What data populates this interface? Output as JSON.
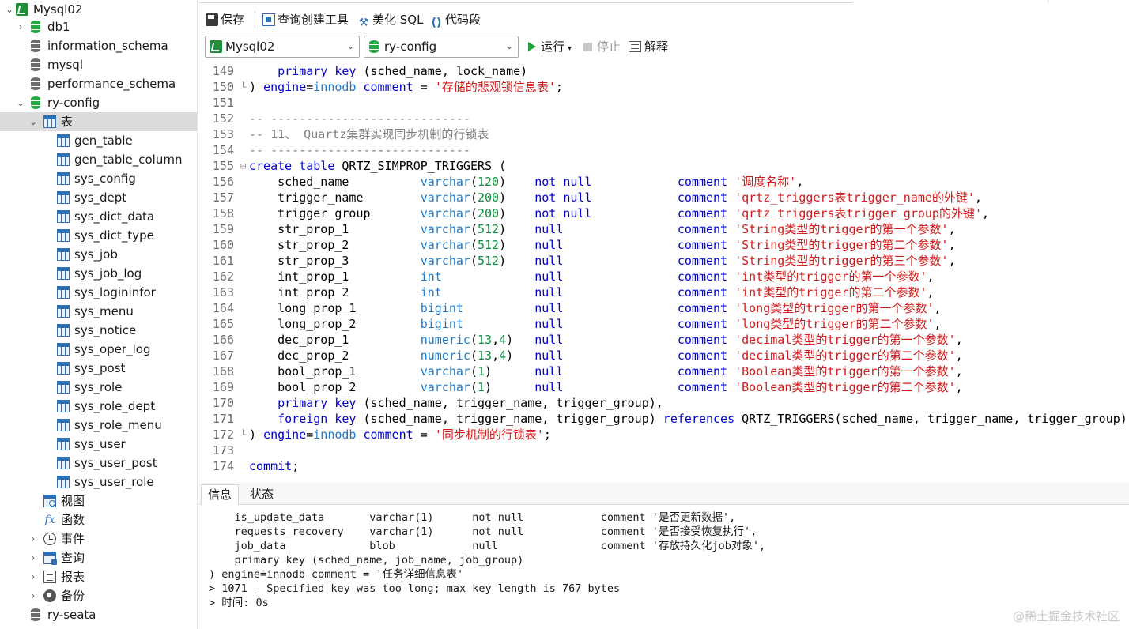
{
  "sidebar": {
    "connection": "Mysql02",
    "databases": {
      "db1": "db1",
      "information_schema": "information_schema",
      "mysql": "mysql",
      "performance_schema": "performance_schema",
      "ry_config": "ry-config",
      "ry_seata": "ry-seata"
    },
    "tables_folder": "表",
    "tables": [
      "gen_table",
      "gen_table_column",
      "sys_config",
      "sys_dept",
      "sys_dict_data",
      "sys_dict_type",
      "sys_job",
      "sys_job_log",
      "sys_logininfor",
      "sys_menu",
      "sys_notice",
      "sys_oper_log",
      "sys_post",
      "sys_role",
      "sys_role_dept",
      "sys_role_menu",
      "sys_user",
      "sys_user_post",
      "sys_user_role"
    ],
    "views": "视图",
    "functions": "函数",
    "events": "事件",
    "queries": "查询",
    "reports": "报表",
    "backups": "备份"
  },
  "toolbar": {
    "save": "保存",
    "query_builder": "查询创建工具",
    "beautify": "美化 SQL",
    "snippet": "代码段"
  },
  "selectors": {
    "connection": "Mysql02",
    "database": "ry-config",
    "run": "运行",
    "stop": "停止",
    "explain": "解释"
  },
  "editor": {
    "lines": [
      {
        "n": "149",
        "fold": "",
        "segs": [
          [
            "pl",
            "    "
          ],
          [
            "kw",
            "primary key"
          ],
          [
            "pl",
            " (sched_name, lock_name)"
          ]
        ]
      },
      {
        "n": "150",
        "fold": "└",
        "segs": [
          [
            "pl",
            ") "
          ],
          [
            "kw",
            "engine"
          ],
          [
            "pl",
            "="
          ],
          [
            "ty",
            "innodb"
          ],
          [
            "pl",
            " "
          ],
          [
            "kw",
            "comment"
          ],
          [
            "pl",
            " = "
          ],
          [
            "str",
            "'存储的悲观锁信息表'"
          ],
          [
            "pl",
            ";"
          ]
        ]
      },
      {
        "n": "151",
        "fold": "",
        "segs": []
      },
      {
        "n": "152",
        "fold": "",
        "segs": [
          [
            "cm",
            "-- ----------------------------"
          ]
        ]
      },
      {
        "n": "153",
        "fold": "",
        "segs": [
          [
            "cm",
            "-- 11、 Quartz集群实现同步机制的行锁表"
          ]
        ]
      },
      {
        "n": "154",
        "fold": "",
        "segs": [
          [
            "cm",
            "-- ----------------------------"
          ]
        ]
      },
      {
        "n": "155",
        "fold": "⊟",
        "segs": [
          [
            "kw",
            "create table"
          ],
          [
            "pl",
            " QRTZ_SIMPROP_TRIGGERS ("
          ]
        ]
      },
      {
        "n": "156",
        "fold": "",
        "segs": [
          [
            "pl",
            "    sched_name          "
          ],
          [
            "ty",
            "varchar"
          ],
          [
            "pl",
            "("
          ],
          [
            "num",
            "120"
          ],
          [
            "pl",
            ")    "
          ],
          [
            "kw",
            "not null"
          ],
          [
            "pl",
            "            "
          ],
          [
            "kw",
            "comment"
          ],
          [
            "pl",
            " "
          ],
          [
            "str",
            "'调度名称'"
          ],
          [
            "pl",
            ","
          ]
        ]
      },
      {
        "n": "157",
        "fold": "",
        "segs": [
          [
            "pl",
            "    trigger_name        "
          ],
          [
            "ty",
            "varchar"
          ],
          [
            "pl",
            "("
          ],
          [
            "num",
            "200"
          ],
          [
            "pl",
            ")    "
          ],
          [
            "kw",
            "not null"
          ],
          [
            "pl",
            "            "
          ],
          [
            "kw",
            "comment"
          ],
          [
            "pl",
            " "
          ],
          [
            "str",
            "'qrtz_triggers表trigger_name的外键'"
          ],
          [
            "pl",
            ","
          ]
        ]
      },
      {
        "n": "158",
        "fold": "",
        "segs": [
          [
            "pl",
            "    trigger_group       "
          ],
          [
            "ty",
            "varchar"
          ],
          [
            "pl",
            "("
          ],
          [
            "num",
            "200"
          ],
          [
            "pl",
            ")    "
          ],
          [
            "kw",
            "not null"
          ],
          [
            "pl",
            "            "
          ],
          [
            "kw",
            "comment"
          ],
          [
            "pl",
            " "
          ],
          [
            "str",
            "'qrtz_triggers表trigger_group的外键'"
          ],
          [
            "pl",
            ","
          ]
        ]
      },
      {
        "n": "159",
        "fold": "",
        "segs": [
          [
            "pl",
            "    str_prop_1          "
          ],
          [
            "ty",
            "varchar"
          ],
          [
            "pl",
            "("
          ],
          [
            "num",
            "512"
          ],
          [
            "pl",
            ")    "
          ],
          [
            "kw",
            "null"
          ],
          [
            "pl",
            "                "
          ],
          [
            "kw",
            "comment"
          ],
          [
            "pl",
            " "
          ],
          [
            "str",
            "'String类型的trigger的第一个参数'"
          ],
          [
            "pl",
            ","
          ]
        ]
      },
      {
        "n": "160",
        "fold": "",
        "segs": [
          [
            "pl",
            "    str_prop_2          "
          ],
          [
            "ty",
            "varchar"
          ],
          [
            "pl",
            "("
          ],
          [
            "num",
            "512"
          ],
          [
            "pl",
            ")    "
          ],
          [
            "kw",
            "null"
          ],
          [
            "pl",
            "                "
          ],
          [
            "kw",
            "comment"
          ],
          [
            "pl",
            " "
          ],
          [
            "str",
            "'String类型的trigger的第二个参数'"
          ],
          [
            "pl",
            ","
          ]
        ]
      },
      {
        "n": "161",
        "fold": "",
        "segs": [
          [
            "pl",
            "    str_prop_3          "
          ],
          [
            "ty",
            "varchar"
          ],
          [
            "pl",
            "("
          ],
          [
            "num",
            "512"
          ],
          [
            "pl",
            ")    "
          ],
          [
            "kw",
            "null"
          ],
          [
            "pl",
            "                "
          ],
          [
            "kw",
            "comment"
          ],
          [
            "pl",
            " "
          ],
          [
            "str",
            "'String类型的trigger的第三个参数'"
          ],
          [
            "pl",
            ","
          ]
        ]
      },
      {
        "n": "162",
        "fold": "",
        "segs": [
          [
            "pl",
            "    int_prop_1          "
          ],
          [
            "ty",
            "int"
          ],
          [
            "pl",
            "             "
          ],
          [
            "kw",
            "null"
          ],
          [
            "pl",
            "                "
          ],
          [
            "kw",
            "comment"
          ],
          [
            "pl",
            " "
          ],
          [
            "str",
            "'int类型的trigger的第一个参数'"
          ],
          [
            "pl",
            ","
          ]
        ]
      },
      {
        "n": "163",
        "fold": "",
        "segs": [
          [
            "pl",
            "    int_prop_2          "
          ],
          [
            "ty",
            "int"
          ],
          [
            "pl",
            "             "
          ],
          [
            "kw",
            "null"
          ],
          [
            "pl",
            "                "
          ],
          [
            "kw",
            "comment"
          ],
          [
            "pl",
            " "
          ],
          [
            "str",
            "'int类型的trigger的第二个参数'"
          ],
          [
            "pl",
            ","
          ]
        ]
      },
      {
        "n": "164",
        "fold": "",
        "segs": [
          [
            "pl",
            "    long_prop_1         "
          ],
          [
            "ty",
            "bigint"
          ],
          [
            "pl",
            "          "
          ],
          [
            "kw",
            "null"
          ],
          [
            "pl",
            "                "
          ],
          [
            "kw",
            "comment"
          ],
          [
            "pl",
            " "
          ],
          [
            "str",
            "'long类型的trigger的第一个参数'"
          ],
          [
            "pl",
            ","
          ]
        ]
      },
      {
        "n": "165",
        "fold": "",
        "segs": [
          [
            "pl",
            "    long_prop_2         "
          ],
          [
            "ty",
            "bigint"
          ],
          [
            "pl",
            "          "
          ],
          [
            "kw",
            "null"
          ],
          [
            "pl",
            "                "
          ],
          [
            "kw",
            "comment"
          ],
          [
            "pl",
            " "
          ],
          [
            "str",
            "'long类型的trigger的第二个参数'"
          ],
          [
            "pl",
            ","
          ]
        ]
      },
      {
        "n": "166",
        "fold": "",
        "segs": [
          [
            "pl",
            "    dec_prop_1          "
          ],
          [
            "ty",
            "numeric"
          ],
          [
            "pl",
            "("
          ],
          [
            "num",
            "13"
          ],
          [
            "pl",
            ","
          ],
          [
            "num",
            "4"
          ],
          [
            "pl",
            ")   "
          ],
          [
            "kw",
            "null"
          ],
          [
            "pl",
            "                "
          ],
          [
            "kw",
            "comment"
          ],
          [
            "pl",
            " "
          ],
          [
            "str",
            "'decimal类型的trigger的第一个参数'"
          ],
          [
            "pl",
            ","
          ]
        ]
      },
      {
        "n": "167",
        "fold": "",
        "segs": [
          [
            "pl",
            "    dec_prop_2          "
          ],
          [
            "ty",
            "numeric"
          ],
          [
            "pl",
            "("
          ],
          [
            "num",
            "13"
          ],
          [
            "pl",
            ","
          ],
          [
            "num",
            "4"
          ],
          [
            "pl",
            ")   "
          ],
          [
            "kw",
            "null"
          ],
          [
            "pl",
            "                "
          ],
          [
            "kw",
            "comment"
          ],
          [
            "pl",
            " "
          ],
          [
            "str",
            "'decimal类型的trigger的第二个参数'"
          ],
          [
            "pl",
            ","
          ]
        ]
      },
      {
        "n": "168",
        "fold": "",
        "segs": [
          [
            "pl",
            "    bool_prop_1         "
          ],
          [
            "ty",
            "varchar"
          ],
          [
            "pl",
            "("
          ],
          [
            "num",
            "1"
          ],
          [
            "pl",
            ")      "
          ],
          [
            "kw",
            "null"
          ],
          [
            "pl",
            "                "
          ],
          [
            "kw",
            "comment"
          ],
          [
            "pl",
            " "
          ],
          [
            "str",
            "'Boolean类型的trigger的第一个参数'"
          ],
          [
            "pl",
            ","
          ]
        ]
      },
      {
        "n": "169",
        "fold": "",
        "segs": [
          [
            "pl",
            "    bool_prop_2         "
          ],
          [
            "ty",
            "varchar"
          ],
          [
            "pl",
            "("
          ],
          [
            "num",
            "1"
          ],
          [
            "pl",
            ")      "
          ],
          [
            "kw",
            "null"
          ],
          [
            "pl",
            "                "
          ],
          [
            "kw",
            "comment"
          ],
          [
            "pl",
            " "
          ],
          [
            "str",
            "'Boolean类型的trigger的第二个参数'"
          ],
          [
            "pl",
            ","
          ]
        ]
      },
      {
        "n": "170",
        "fold": "",
        "segs": [
          [
            "pl",
            "    "
          ],
          [
            "kw",
            "primary key"
          ],
          [
            "pl",
            " (sched_name, trigger_name, trigger_group),"
          ]
        ]
      },
      {
        "n": "171",
        "fold": "",
        "segs": [
          [
            "pl",
            "    "
          ],
          [
            "kw",
            "foreign key"
          ],
          [
            "pl",
            " (sched_name, trigger_name, trigger_group) "
          ],
          [
            "kw",
            "references"
          ],
          [
            "pl",
            " QRTZ_TRIGGERS(sched_name, trigger_name, trigger_group)"
          ]
        ]
      },
      {
        "n": "172",
        "fold": "└",
        "segs": [
          [
            "pl",
            ") "
          ],
          [
            "kw",
            "engine"
          ],
          [
            "pl",
            "="
          ],
          [
            "ty",
            "innodb"
          ],
          [
            "pl",
            " "
          ],
          [
            "kw",
            "comment"
          ],
          [
            "pl",
            " = "
          ],
          [
            "str",
            "'同步机制的行锁表'"
          ],
          [
            "pl",
            ";"
          ]
        ]
      },
      {
        "n": "173",
        "fold": "",
        "segs": []
      },
      {
        "n": "174",
        "fold": "",
        "segs": [
          [
            "kw",
            "commit"
          ],
          [
            "pl",
            ";"
          ]
        ]
      }
    ]
  },
  "bottom": {
    "tab_info": "信息",
    "tab_status": "状态",
    "output": [
      "    is_update_data       varchar(1)      not null            comment '是否更新数据',",
      "    requests_recovery    varchar(1)      not null            comment '是否接受恢复执行',",
      "    job_data             blob            null                comment '存放持久化job对象',",
      "    primary key (sched_name, job_name, job_group)",
      ") engine=innodb comment = '任务详细信息表'",
      "> 1071 - Specified key was too long; max key length is 767 bytes",
      "> 时间: 0s"
    ],
    "watermark": "@稀土掘金技术社区"
  }
}
